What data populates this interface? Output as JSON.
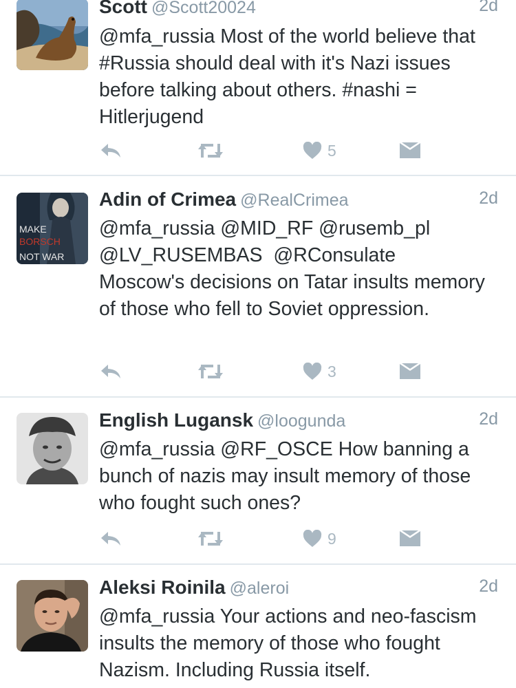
{
  "colors": {
    "meta_gray": "#8899a6",
    "icon_gray": "#aab8c2",
    "divider": "#e1e8ed",
    "text": "#292f33"
  },
  "tweets": [
    {
      "name": "Scott",
      "handle": "@Scott20024",
      "time": "2d",
      "text": "@mfa_russia Most of the world believe that #Russia should deal with it's Nazi issues before talking about others. #nashi = Hitlerjugend",
      "likes": "5",
      "avatar": "sea-lion-photo"
    },
    {
      "name": "Adin of Crimea",
      "handle": "@RealCrimea",
      "time": "2d",
      "text": "@mfa_russia @MID_RF @rusemb_pl\n@LV_RUSEMBAS  @RConsulate\nMoscow's decisions on Tatar insults memory of those who fell to Soviet oppression.",
      "likes": "3",
      "avatar": "make-borsch-not-war-poster",
      "avatar_text": {
        "line1": "MAKE",
        "line2": "BORSCH",
        "line3": "NOT WAR"
      }
    },
    {
      "name": "English Lugansk",
      "handle": "@loogunda",
      "time": "2d",
      "text": "@mfa_russia @RF_OSCE How banning a bunch of nazis may insult memory of those who fought such ones?",
      "likes": "9",
      "avatar": "man-in-cap-photo"
    },
    {
      "name": "Aleksi Roinila",
      "handle": "@aleroi",
      "time": "2d",
      "text": "@mfa_russia Your actions and neo-fascism insults the memory of those who fought Nazism. Including Russia itself.",
      "avatar": "young-man-photo"
    }
  ]
}
